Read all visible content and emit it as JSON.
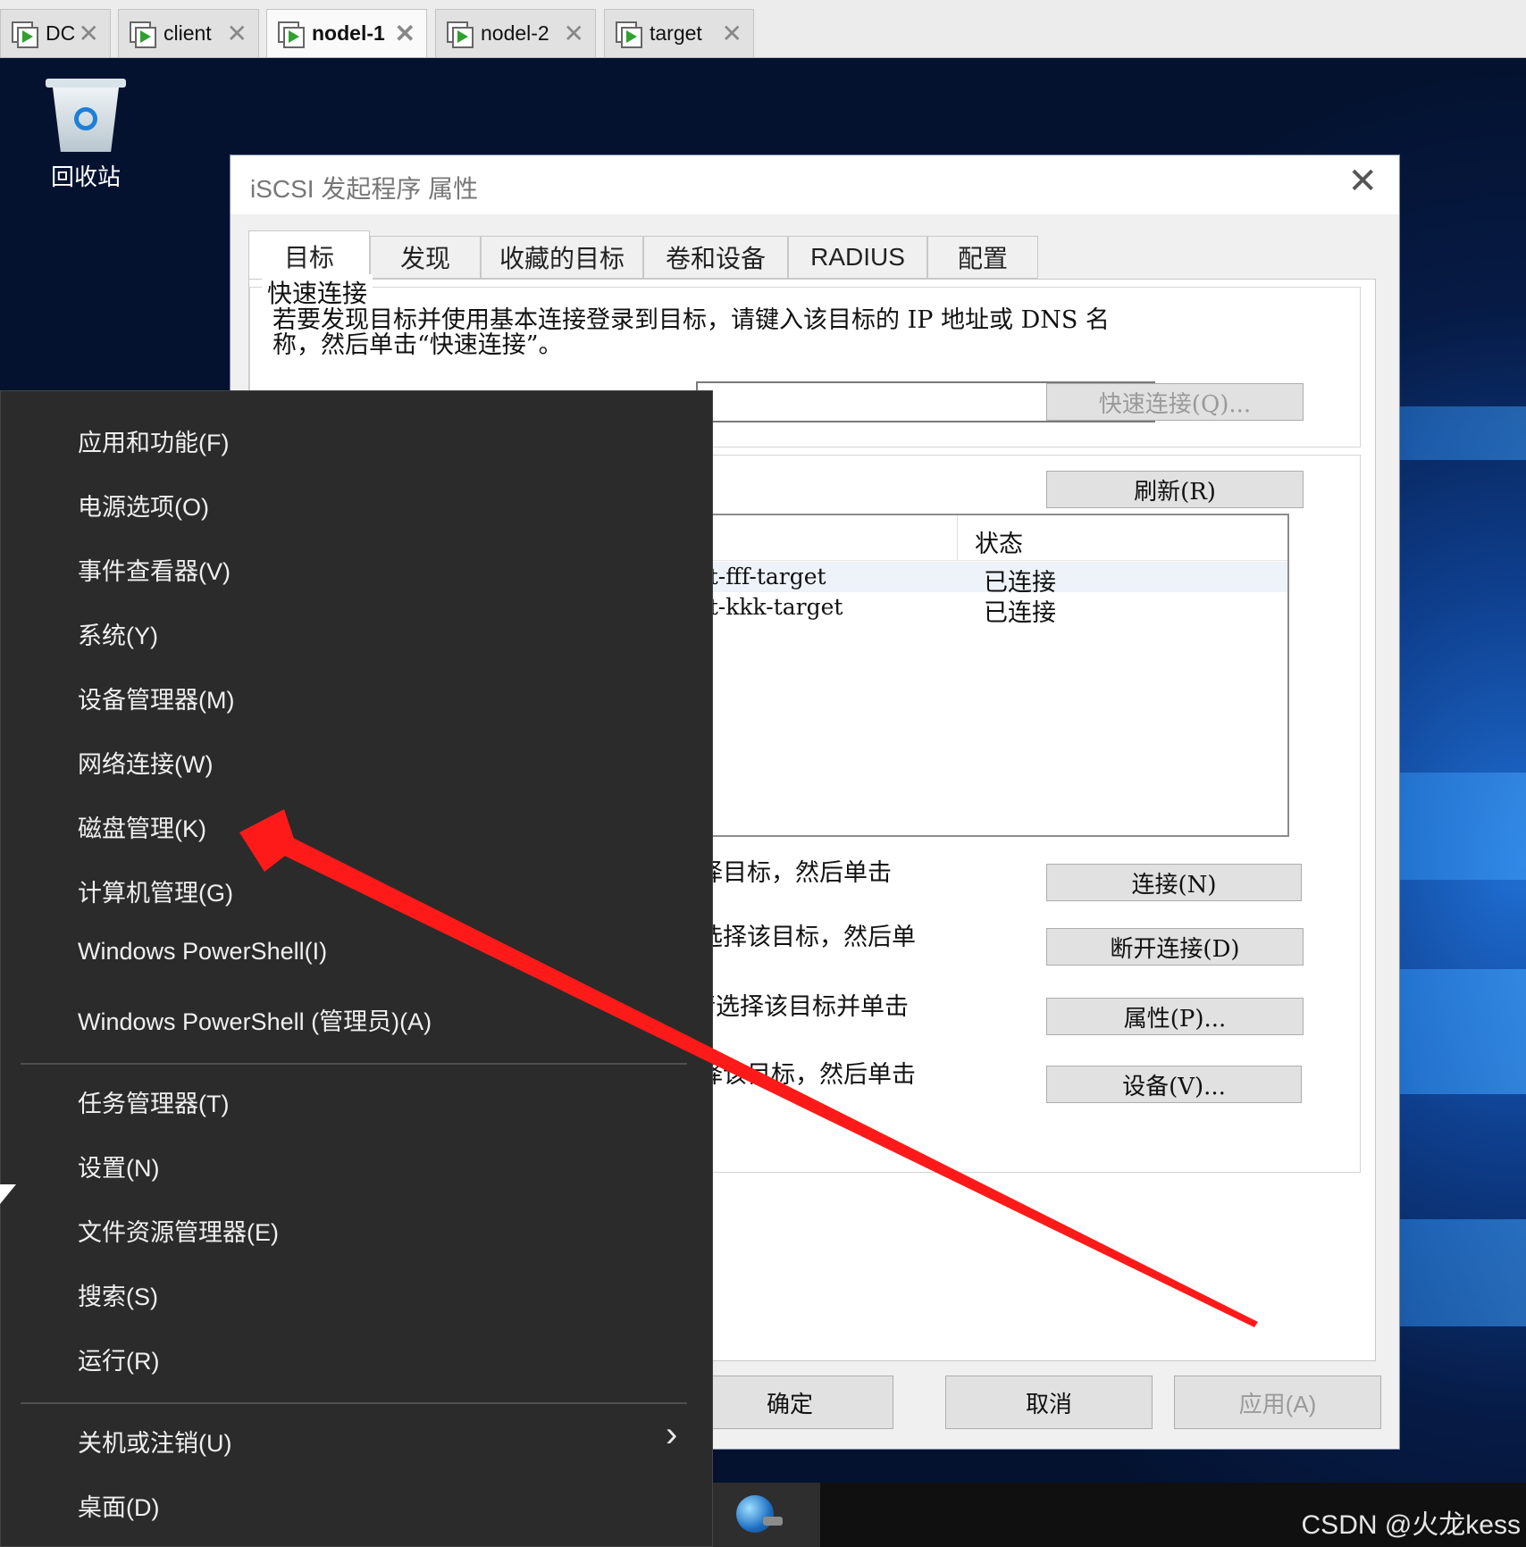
{
  "vm_tabs": [
    {
      "label": "DC",
      "active": false
    },
    {
      "label": "client",
      "active": false
    },
    {
      "label": "nodel-1",
      "active": true
    },
    {
      "label": "nodel-2",
      "active": false
    },
    {
      "label": "target",
      "active": false
    }
  ],
  "desktop": {
    "recycle_bin_label": "回收站"
  },
  "dialog": {
    "title": "iSCSI 发起程序 属性",
    "tabs": [
      "目标",
      "发现",
      "收藏的目标",
      "卷和设备",
      "RADIUS",
      "配置"
    ],
    "quick_connect": {
      "group_label": "快速连接",
      "description_line1": "若要发现目标并使用基本连接登录到目标，请键入该目标的 IP 地址或 DNS 名",
      "description_line2": "称，然后单击“快速连接”。",
      "button": "快速连接(Q)..."
    },
    "refresh_button": "刷新(R)",
    "list": {
      "status_header": "状态",
      "rows": [
        {
          "name": "rget-fff-target",
          "status": "已连接"
        },
        {
          "name": "rget-kkk-target",
          "status": "已连接"
        }
      ]
    },
    "actions": [
      {
        "text": "选择目标，然后单击",
        "button": "连接(N)"
      },
      {
        "text": "请选择该目标，然后单",
        "button": "断开连接(D)"
      },
      {
        "text": "请选择该目标并单击",
        "button": "属性(P)..."
      },
      {
        "text": "选择该目标，然后单击",
        "button": "设备(V)..."
      }
    ],
    "footer": {
      "ok": "确定",
      "cancel": "取消",
      "apply": "应用(A)"
    }
  },
  "context_menu": {
    "group1": [
      "应用和功能(F)",
      "电源选项(O)",
      "事件查看器(V)",
      "系统(Y)",
      "设备管理器(M)",
      "网络连接(W)",
      "磁盘管理(K)",
      "计算机管理(G)",
      "Windows PowerShell(I)",
      "Windows PowerShell (管理员)(A)"
    ],
    "group2": [
      "任务管理器(T)",
      "设置(N)",
      "文件资源管理器(E)",
      "搜索(S)",
      "运行(R)"
    ],
    "group3": [
      "关机或注销(U)",
      "桌面(D)"
    ]
  },
  "watermark": "CSDN @火龙kess",
  "colors": {
    "arrow": "#ff1a1a",
    "menu_bg": "#2b2b2b",
    "desktop_accent": "#2a82e0"
  }
}
